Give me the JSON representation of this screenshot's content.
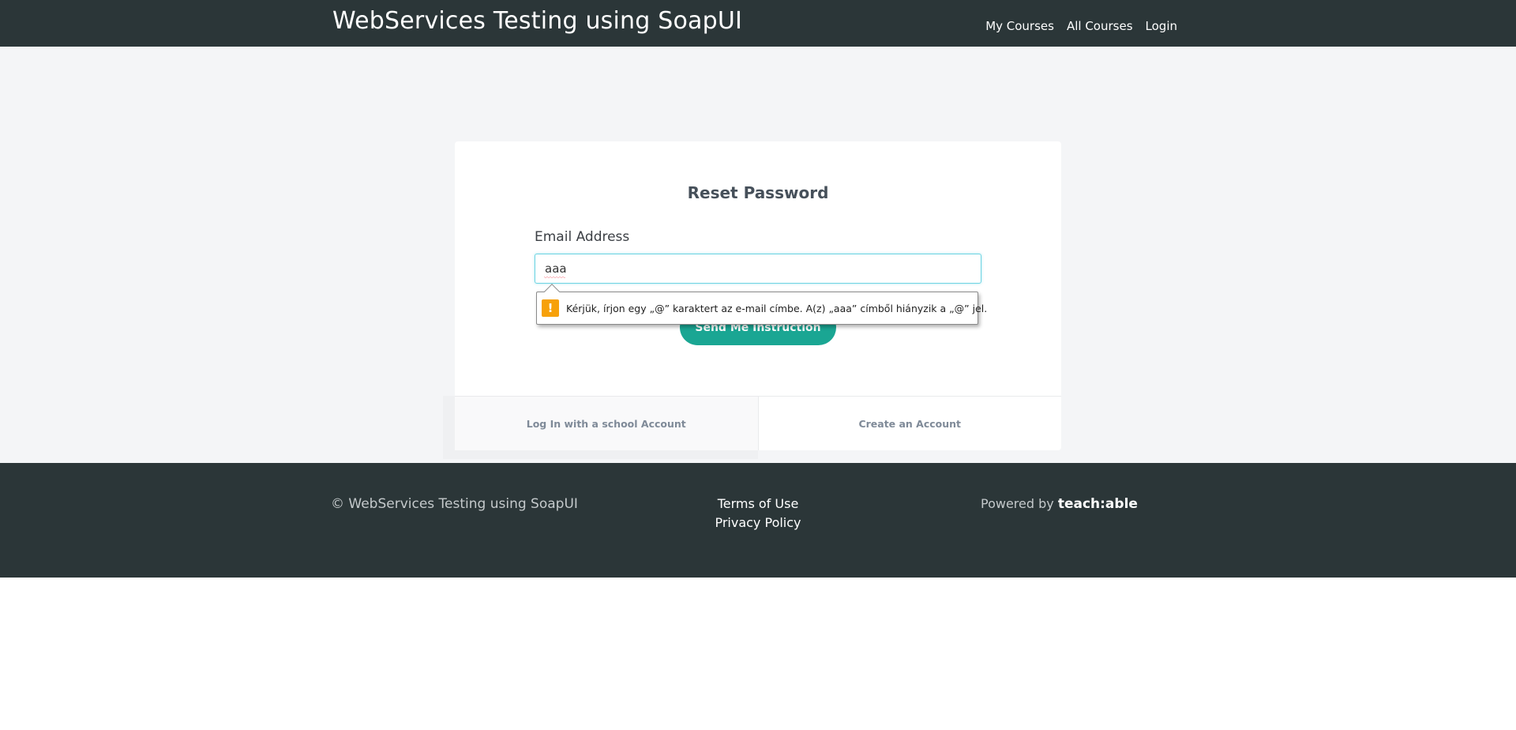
{
  "header": {
    "brand": "WebServices Testing using SoapUI",
    "nav": [
      "My Courses",
      "All Courses",
      "Login"
    ]
  },
  "reset": {
    "title": "Reset Password",
    "email_label": "Email Address",
    "email_value": "aaa",
    "send_button": "Send Me Instruction",
    "validation_icon": "!",
    "validation_message": "Kérjük, írjon egy „@” karaktert az e-mail címbe. A(z) „aaa” címből hiányzik a „@” jel.",
    "login_school": "Log In with a school Account",
    "create_account": "Create an Account"
  },
  "footer": {
    "copyright": "© WebServices Testing using SoapUI",
    "terms": "Terms of Use",
    "privacy": "Privacy Policy",
    "powered_by": "Powered by",
    "logo": "teach:able"
  },
  "colors": {
    "header_bg": "#2b3638",
    "accent": "#1aa693",
    "warning": "#f7a10a"
  }
}
